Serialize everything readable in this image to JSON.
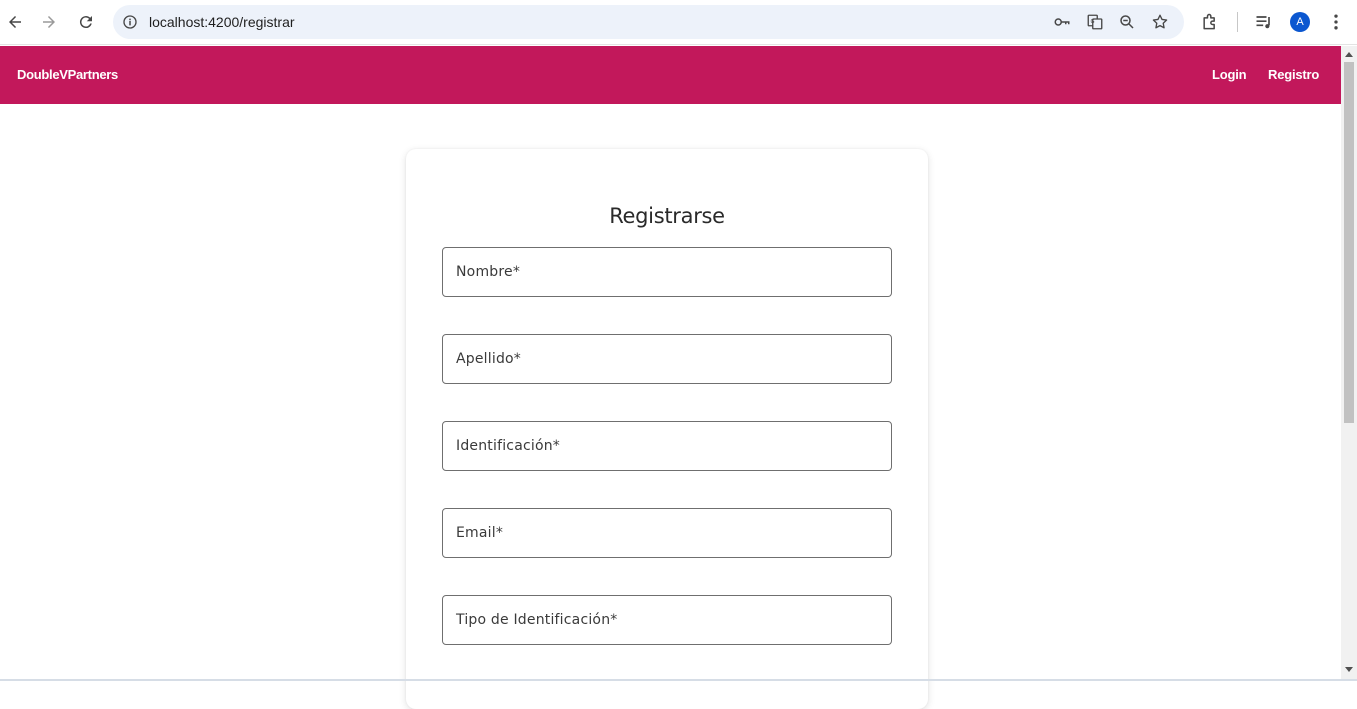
{
  "browser": {
    "url": "localhost:4200/registrar",
    "avatar_letter": "A"
  },
  "header": {
    "brand": "DoubleVPartners",
    "nav": [
      {
        "label": "Login"
      },
      {
        "label": "Registro"
      }
    ],
    "color": "#c2185b"
  },
  "form": {
    "title": "Registrarse",
    "fields": [
      {
        "label": "Nombre*"
      },
      {
        "label": "Apellido*"
      },
      {
        "label": "Identificación*"
      },
      {
        "label": "Email*"
      },
      {
        "label": "Tipo de Identificación*"
      }
    ]
  },
  "icons": [
    "back-arrow-icon",
    "forward-arrow-icon",
    "reload-icon",
    "site-info-icon",
    "password-key-icon",
    "translate-icon",
    "zoom-icon",
    "bookmark-star-icon",
    "extensions-icon",
    "media-control-icon",
    "menu-dots-icon"
  ]
}
